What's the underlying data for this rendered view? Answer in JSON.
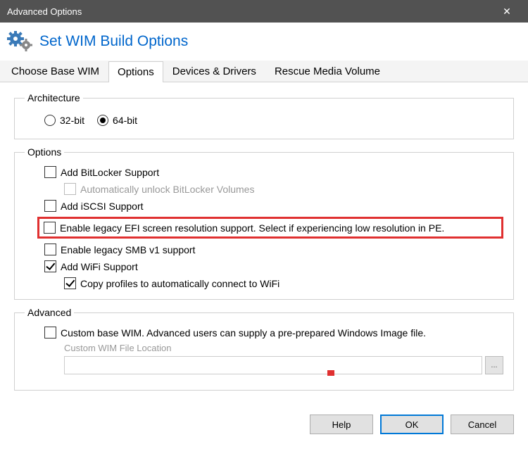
{
  "titlebar": "Advanced Options",
  "header": "Set WIM Build Options",
  "tabs": {
    "choose": "Choose Base WIM",
    "options": "Options",
    "devices": "Devices & Drivers",
    "rescue": "Rescue Media Volume"
  },
  "architecture": {
    "legend": "Architecture",
    "opt32": "32-bit",
    "opt64": "64-bit"
  },
  "options": {
    "legend": "Options",
    "bitlocker": "Add BitLocker Support",
    "autounlock": "Automatically unlock BitLocker Volumes",
    "iscsi": "Add iSCSI Support",
    "efi": "Enable legacy EFI screen resolution support.  Select if experiencing low resolution in PE.",
    "smb": "Enable legacy SMB v1 support",
    "wifi": "Add WiFi Support",
    "copyprofiles": "Copy profiles to automatically connect to WiFi"
  },
  "advanced": {
    "legend": "Advanced",
    "custom": "Custom base WIM. Advanced users can supply a pre-prepared Windows Image file.",
    "wimlabel": "Custom WIM File Location",
    "browse": "..."
  },
  "buttons": {
    "help": "Help",
    "ok": "OK",
    "cancel": "Cancel"
  }
}
